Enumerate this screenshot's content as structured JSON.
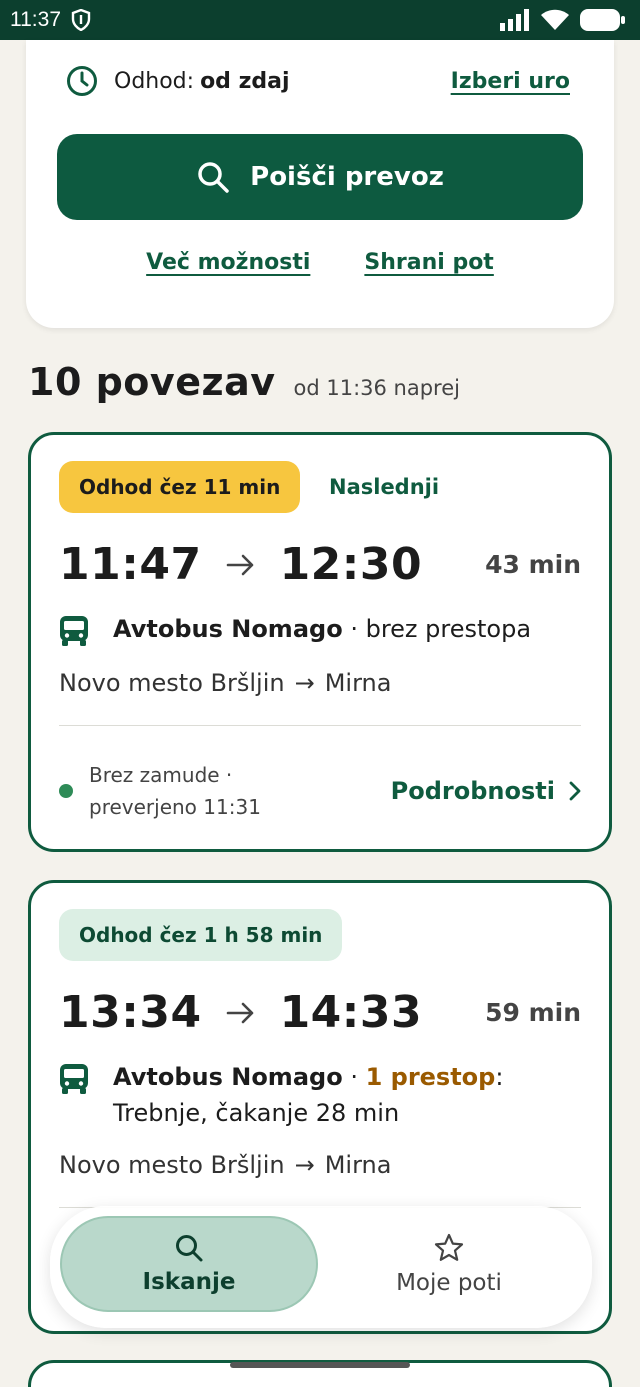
{
  "status_bar": {
    "time": "11:37"
  },
  "search": {
    "departure_label": "Odhod:",
    "departure_value": "od zdaj",
    "choose_time": "Izberi uro",
    "search_button": "Poišči prevoz",
    "more_options": "Več možnosti",
    "save_route": "Shrani pot"
  },
  "results": {
    "title": "10 povezav",
    "subtitle": "od 11:36 naprej",
    "connections": [
      {
        "badge": "Odhod čez 11 min",
        "tag": "Naslednji",
        "depart": "11:47",
        "arrive": "12:30",
        "duration": "43 min",
        "operator": "Avtobus Nomago",
        "transfer_text": "· brez prestopa",
        "from": "Novo mesto Bršljin",
        "arrow": "→",
        "to": "Mirna",
        "status_line1": "Brez zamude ·",
        "status_line2": "preverjeno 11:31",
        "details": "Podrobnosti"
      },
      {
        "badge": "Odhod čez 1 h 58 min",
        "depart": "13:34",
        "arrive": "14:33",
        "duration": "59 min",
        "operator": "Avtobus Nomago",
        "sep": " · ",
        "transfer": "1 prestop",
        "transfer_suffix": ":",
        "transfer_detail": "Trebnje, čakanje 28 min",
        "from": "Novo mesto Bršljin",
        "arrow": "→",
        "to": "Mirna"
      }
    ]
  },
  "nav": {
    "search": "Iskanje",
    "my_routes": "Moje poti"
  },
  "colors": {
    "brand_green": "#0d5a40",
    "status_bar": "#0c3f2e",
    "warn_badge": "#f7c63f",
    "transfer": "#9a5a00"
  }
}
